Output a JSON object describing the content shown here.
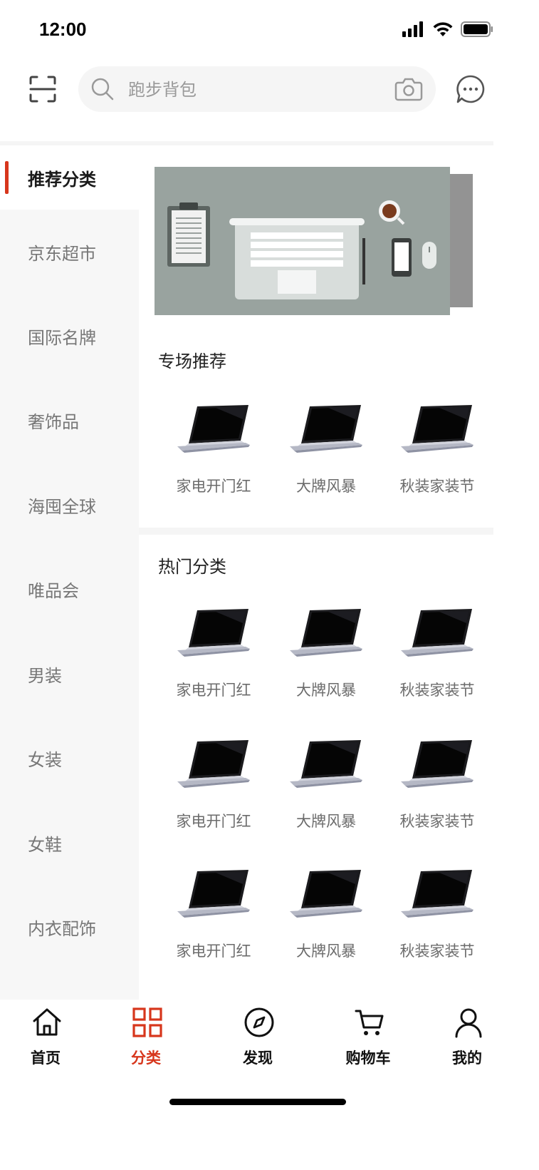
{
  "status": {
    "time": "12:00"
  },
  "search": {
    "placeholder": "跑步背包"
  },
  "sidebar": {
    "items": [
      {
        "label": "推荐分类",
        "active": true
      },
      {
        "label": "京东超市"
      },
      {
        "label": "国际名牌"
      },
      {
        "label": "奢饰品"
      },
      {
        "label": "海囤全球"
      },
      {
        "label": "唯品会"
      },
      {
        "label": "男装"
      },
      {
        "label": "女装"
      },
      {
        "label": "女鞋"
      },
      {
        "label": "内衣配饰"
      }
    ]
  },
  "sections": {
    "special": {
      "title": "专场推荐",
      "items": [
        {
          "label": "家电开门红"
        },
        {
          "label": "大牌风暴"
        },
        {
          "label": "秋装家装节"
        }
      ]
    },
    "hot": {
      "title": "热门分类",
      "items": [
        {
          "label": "家电开门红"
        },
        {
          "label": "大牌风暴"
        },
        {
          "label": "秋装家装节"
        },
        {
          "label": "家电开门红"
        },
        {
          "label": "大牌风暴"
        },
        {
          "label": "秋装家装节"
        },
        {
          "label": "家电开门红"
        },
        {
          "label": "大牌风暴"
        },
        {
          "label": "秋装家装节"
        }
      ]
    }
  },
  "tabbar": {
    "items": [
      {
        "label": "首页",
        "icon": "home-icon"
      },
      {
        "label": "分类",
        "icon": "category-grid-icon",
        "active": true
      },
      {
        "label": "发现",
        "icon": "compass-icon"
      },
      {
        "label": "购物车",
        "icon": "cart-icon"
      },
      {
        "label": "我的",
        "icon": "user-icon"
      }
    ]
  },
  "colors": {
    "accent": "#d7361c",
    "sidebar_bg": "#f7f7f7",
    "banner_bg": "#99a39f"
  }
}
